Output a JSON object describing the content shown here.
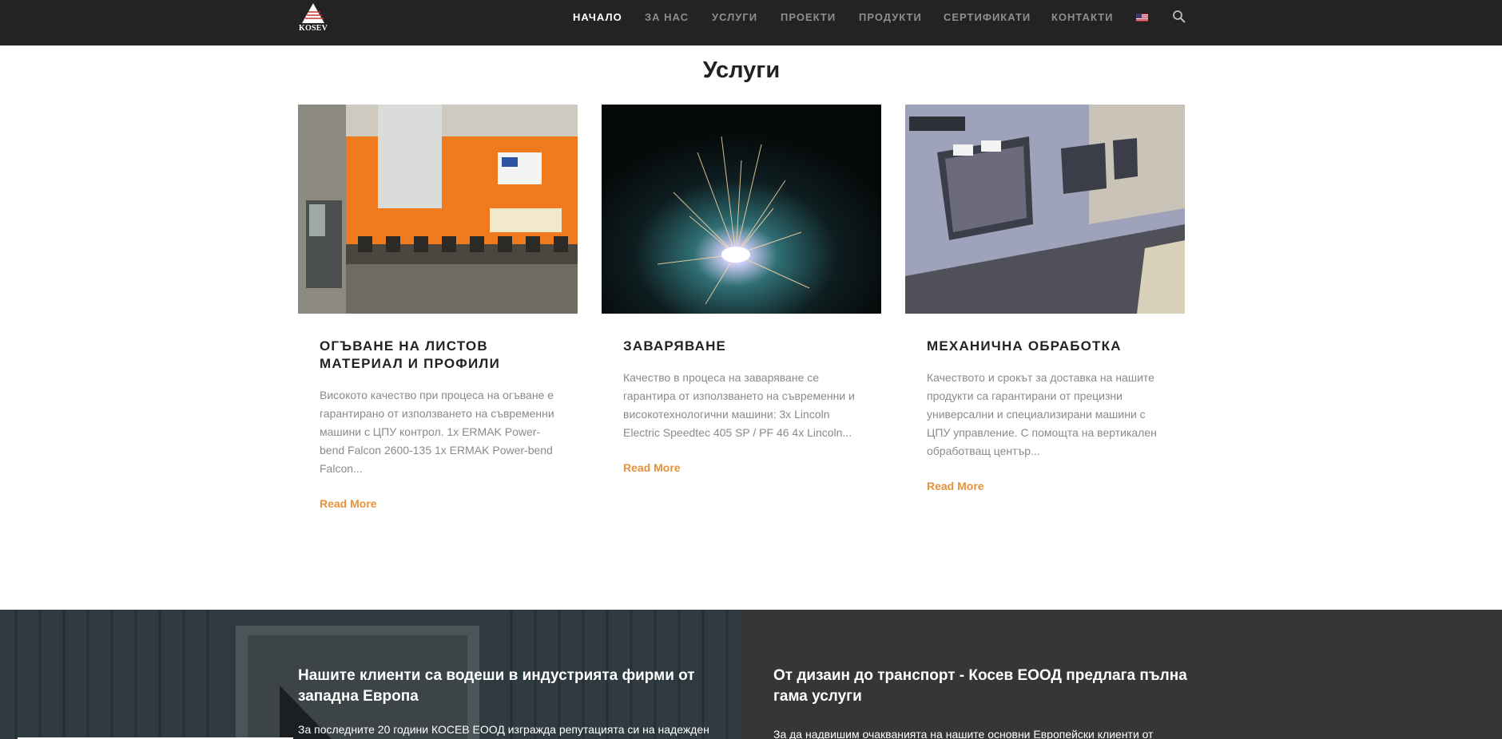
{
  "header": {
    "logo_text": "KOSEV",
    "nav": [
      {
        "label": "НАЧАЛО",
        "active": true
      },
      {
        "label": "ЗА НАС",
        "active": false
      },
      {
        "label": "УСЛУГИ",
        "active": false
      },
      {
        "label": "ПРОЕКТИ",
        "active": false
      },
      {
        "label": "ПРОДУКТИ",
        "active": false
      },
      {
        "label": "СЕРТИФИКАТИ",
        "active": false
      },
      {
        "label": "КОНТАКТИ",
        "active": false
      }
    ],
    "flag_icon": "us-flag-icon",
    "search_icon": "search-icon"
  },
  "services": {
    "title": "Услуги",
    "cards": [
      {
        "title": "ОГЪВАНЕ НА ЛИСТОВ МАТЕРИАЛ И ПРОФИЛИ",
        "text": "Високото качество при процеса на огъване е гарантирано от използването на съвременни машини с ЦПУ контрол. 1x ERMAK Power-bend Falcon 2600-135 1x ERMAK Power-bend Falcon...",
        "link": "Read More"
      },
      {
        "title": "ЗАВАРЯВАНЕ",
        "text": "Качество в процеса на заваряване се гарантира от използването на съвременни и високотехнологични машини: 3x Lincoln Electric Speedtec 405 SP / PF 46 4x Lincoln...",
        "link": "Read More"
      },
      {
        "title": "МЕХАНИЧНА ОБРАБОТКА",
        "text": "Качеството и срокът за доставка на нашите продукти са гарантирани от прецизни универсални и специализирани машини с ЦПУ управление. С помощта на вертикален обработващ център...",
        "link": "Read More"
      }
    ]
  },
  "band": {
    "left_heading": "Нашите клиенти са водеши в индустрията фирми от западна Европа",
    "left_text": "За последните 20 години КОСЕВ ЕООД изгражда репутацията си на надежден",
    "right_heading": "От дизаин до транспорт - Косев ЕООД предлага пълна гама услуги",
    "right_text": "За да надвишим очакванията на нашите основни Европейски клиенти от"
  },
  "colors": {
    "topbar": "#232323",
    "accent": "#e6923a",
    "band_left": "#2f3b40",
    "band_right": "#363636"
  }
}
